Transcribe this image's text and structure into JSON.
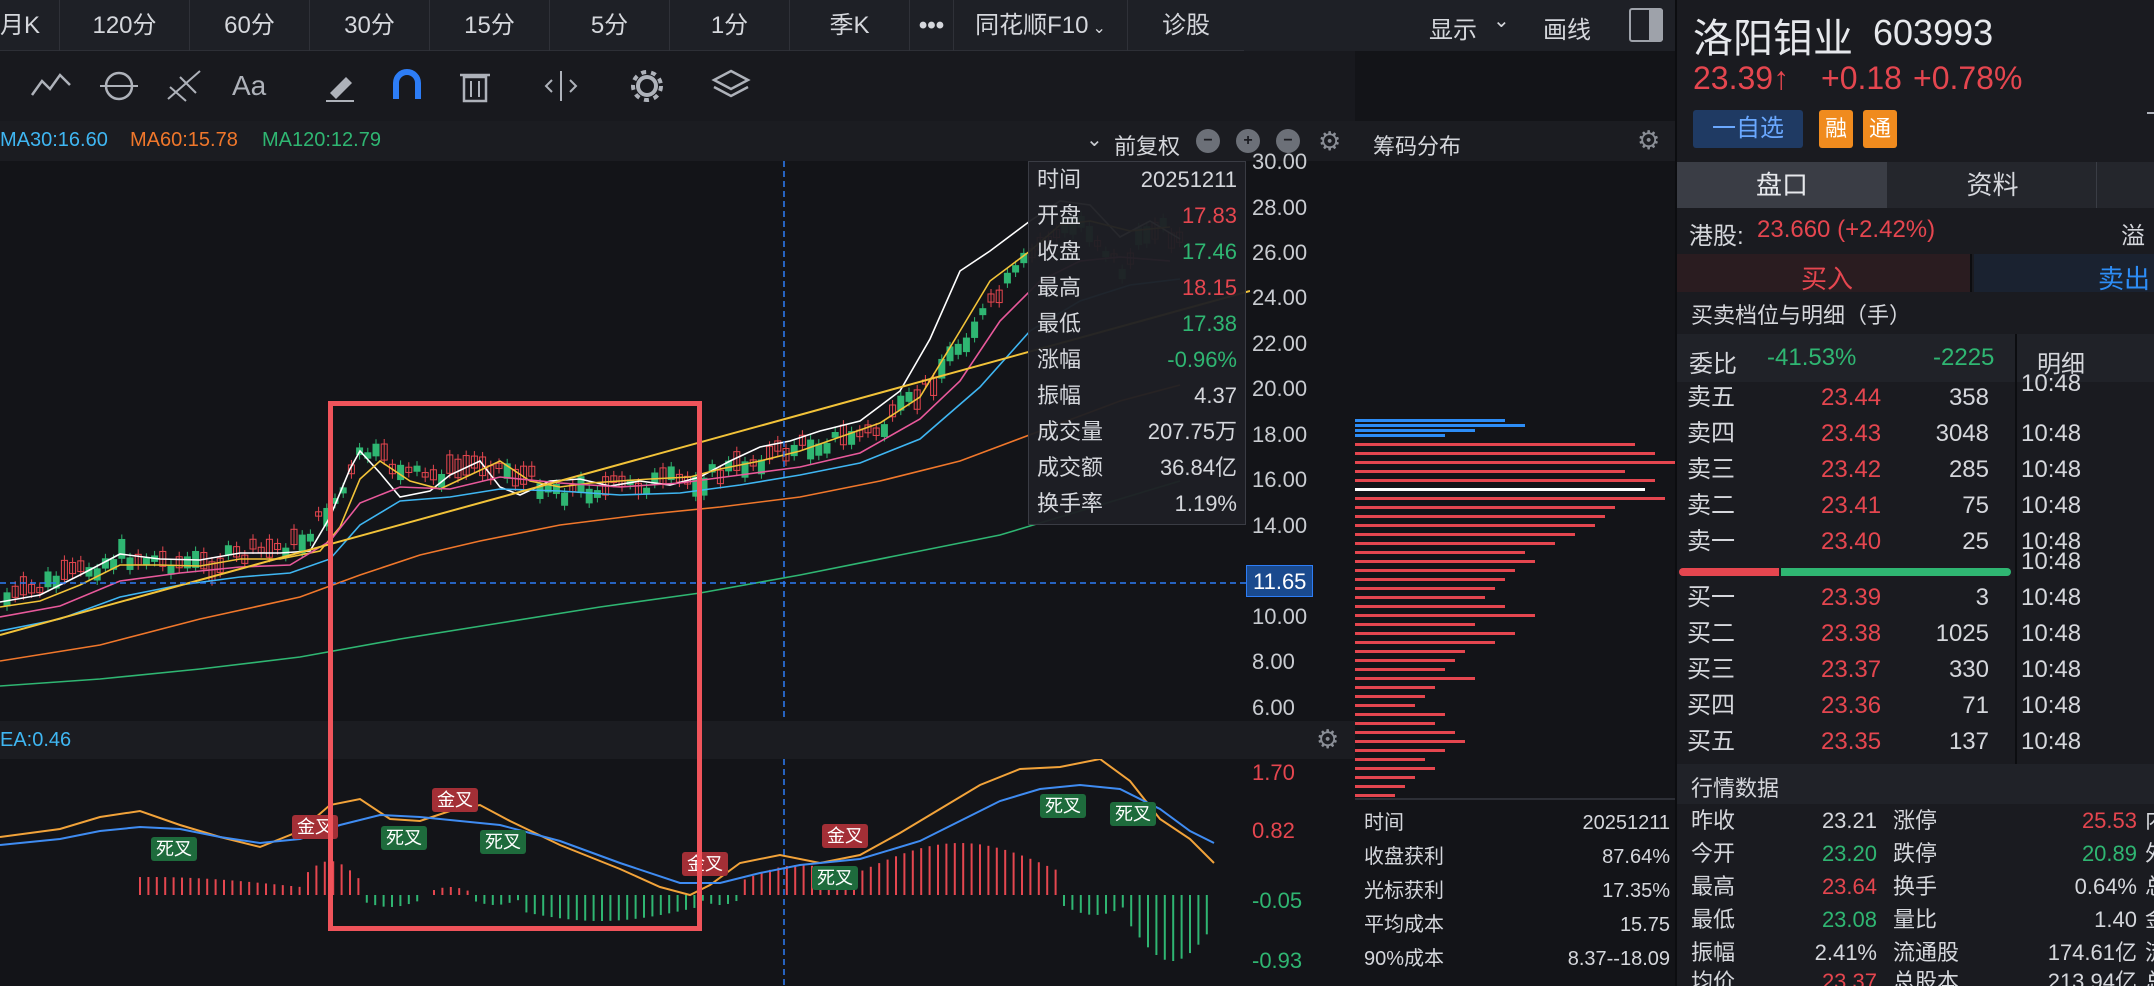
{
  "periods": [
    "月K",
    "120分",
    "60分",
    "30分",
    "15分",
    "5分",
    "1分",
    "季K",
    "•••",
    "同花顺F10",
    "诊股"
  ],
  "top_right": {
    "display": "显示",
    "draw": "画线"
  },
  "ma": {
    "ma30": "MA30:16.60",
    "ma60": "MA60:15.78",
    "ma120": "MA120:12.79"
  },
  "rights_label": "前复权",
  "price_axis": [
    "30.00",
    "28.00",
    "26.00",
    "24.00",
    "22.00",
    "20.00",
    "18.00",
    "16.00",
    "14.00",
    "10.00",
    "8.00",
    "6.00"
  ],
  "crosshair_price": "11.65",
  "macd_label": "EA:0.46",
  "macd_axis": [
    "1.70",
    "0.82",
    "-0.05",
    "-0.93"
  ],
  "tooltip": [
    {
      "label": "时间",
      "value": "20251211",
      "color": "#d5d7dc"
    },
    {
      "label": "开盘",
      "value": "17.83",
      "color": "#e5464f"
    },
    {
      "label": "收盘",
      "value": "17.46",
      "color": "#2fb672"
    },
    {
      "label": "最高",
      "value": "18.15",
      "color": "#e5464f"
    },
    {
      "label": "最低",
      "value": "17.38",
      "color": "#2fb672"
    },
    {
      "label": "涨幅",
      "value": "-0.96%",
      "color": "#2fb672"
    },
    {
      "label": "振幅",
      "value": "4.37",
      "color": "#d5d7dc"
    },
    {
      "label": "成交量",
      "value": "207.75万",
      "color": "#d5d7dc"
    },
    {
      "label": "成交额",
      "value": "36.84亿",
      "color": "#d5d7dc"
    },
    {
      "label": "换手率",
      "value": "1.19%",
      "color": "#d5d7dc"
    }
  ],
  "chip": {
    "title": "筹码分布",
    "rows": [
      {
        "label": "时间",
        "value": "20251211"
      },
      {
        "label": "收盘获利",
        "value": "87.64%"
      },
      {
        "label": "光标获利",
        "value": "17.35%"
      },
      {
        "label": "平均成本",
        "value": "15.75"
      },
      {
        "label": "90%成本",
        "value": "8.37--18.09"
      }
    ]
  },
  "signals": {
    "golden": "金叉",
    "dead": "死叉"
  },
  "stock": {
    "name": "洛阳钼业",
    "code": "603993",
    "price": "23.39↑",
    "change": "+0.18",
    "pct": "+0.78%",
    "watch": "一自选",
    "badge1": "融",
    "badge2": "通"
  },
  "tabs": [
    "盘口",
    "资料"
  ],
  "hk": {
    "label": "港股:",
    "value": "23.660 (+2.42%)",
    "premium": "溢价"
  },
  "trade": {
    "buy": "买入",
    "sell": "卖出"
  },
  "orderbook_title": "买卖档位与明细（手）",
  "weibi": {
    "label": "委比",
    "pct": "-41.53%",
    "diff": "-2225",
    "detail": "明细"
  },
  "asks": [
    {
      "label": "卖五",
      "price": "23.44",
      "vol": "358"
    },
    {
      "label": "卖四",
      "price": "23.43",
      "vol": "3048"
    },
    {
      "label": "卖三",
      "price": "23.42",
      "vol": "285"
    },
    {
      "label": "卖二",
      "price": "23.41",
      "vol": "75"
    },
    {
      "label": "卖一",
      "price": "23.40",
      "vol": "25"
    }
  ],
  "bids": [
    {
      "label": "买一",
      "price": "23.39",
      "vol": "3"
    },
    {
      "label": "买二",
      "price": "23.38",
      "vol": "1025"
    },
    {
      "label": "买三",
      "price": "23.37",
      "vol": "330"
    },
    {
      "label": "买四",
      "price": "23.36",
      "vol": "71"
    },
    {
      "label": "买五",
      "price": "23.35",
      "vol": "137"
    }
  ],
  "detail_times": [
    "10:48",
    "10:48",
    "10:48",
    "10:48",
    "10:48",
    "10:48",
    "10:48",
    "10:48",
    "10:48",
    "10:48",
    "10:48",
    "10:48"
  ],
  "market_title": "行情数据",
  "market": [
    {
      "l1": "昨收",
      "v1": "23.21",
      "c1": "#d5d7dc",
      "l2": "涨停",
      "v2": "25.53",
      "c2": "#e5464f",
      "l3": "内"
    },
    {
      "l1": "今开",
      "v1": "23.20",
      "c1": "#2fb672",
      "l2": "跌停",
      "v2": "20.89",
      "c2": "#2fb672",
      "l3": "外"
    },
    {
      "l1": "最高",
      "v1": "23.64",
      "c1": "#e5464f",
      "l2": "换手",
      "v2": "0.64%",
      "c2": "#d5d7dc",
      "l3": "总"
    },
    {
      "l1": "最低",
      "v1": "23.08",
      "c1": "#2fb672",
      "l2": "量比",
      "v2": "1.40",
      "c2": "#d5d7dc",
      "l3": "金"
    },
    {
      "l1": "振幅",
      "v1": "2.41%",
      "c1": "#d5d7dc",
      "l2": "流通股",
      "v2": "174.61亿",
      "c2": "#d5d7dc",
      "l3": "流"
    },
    {
      "l1": "均价",
      "v1": "23.37",
      "c1": "#e5464f",
      "l2": "总股本",
      "v2": "213.94亿",
      "c2": "#d5d7dc",
      "l3": "总"
    }
  ]
}
